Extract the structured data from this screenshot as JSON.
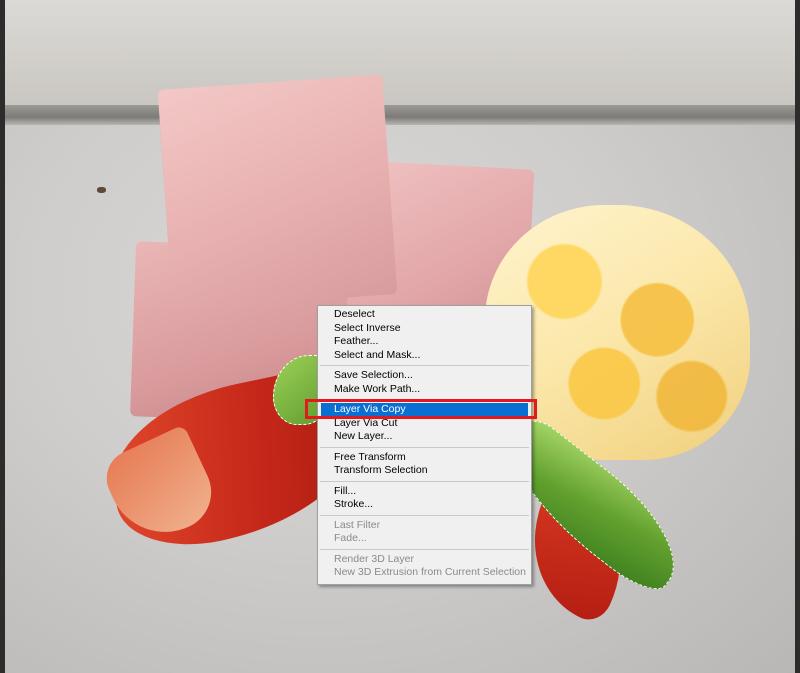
{
  "context_menu": {
    "items": [
      {
        "label": "Deselect",
        "enabled": true
      },
      {
        "label": "Select Inverse",
        "enabled": true
      },
      {
        "label": "Feather...",
        "enabled": true
      },
      {
        "label": "Select and Mask...",
        "enabled": true
      },
      {
        "label": "Save Selection...",
        "enabled": true
      },
      {
        "label": "Make Work Path...",
        "enabled": true
      },
      {
        "label": "Layer Via Copy",
        "enabled": true,
        "highlighted": true
      },
      {
        "label": "Layer Via Cut",
        "enabled": true
      },
      {
        "label": "New Layer...",
        "enabled": true
      },
      {
        "label": "Free Transform",
        "enabled": true
      },
      {
        "label": "Transform Selection",
        "enabled": true
      },
      {
        "label": "Fill...",
        "enabled": true
      },
      {
        "label": "Stroke...",
        "enabled": true
      },
      {
        "label": "Last Filter",
        "enabled": false
      },
      {
        "label": "Fade...",
        "enabled": false
      },
      {
        "label": "Render 3D Layer",
        "enabled": false
      },
      {
        "label": "New 3D Extrusion from Current Selection",
        "enabled": false
      }
    ]
  },
  "colors": {
    "highlight": "#0a6fd3",
    "callout": "#e3191d",
    "menu_bg": "#f0f0f0",
    "disabled_text": "#8a8a8a"
  }
}
